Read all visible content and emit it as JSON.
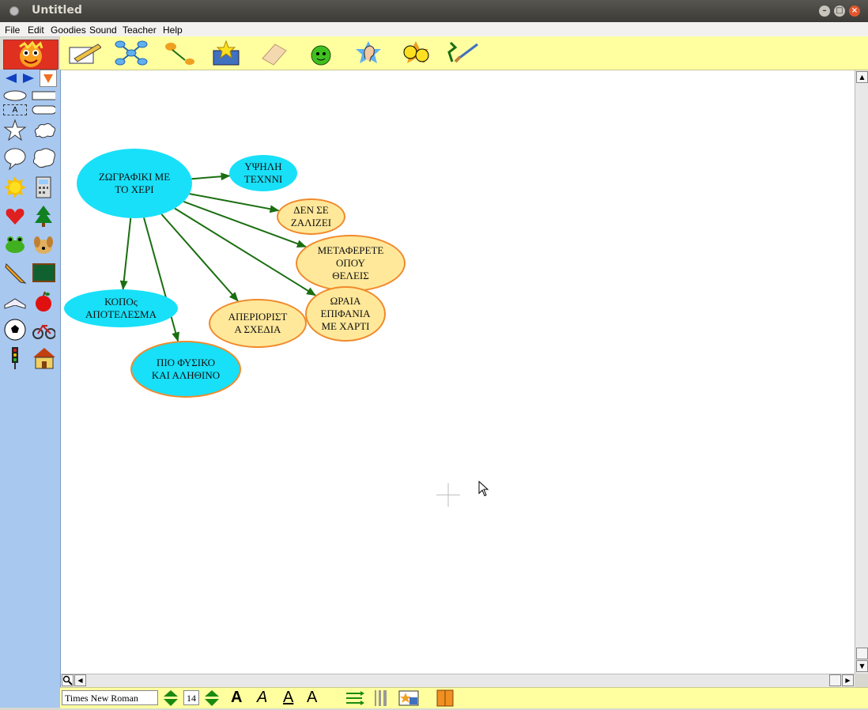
{
  "window": {
    "title": "Untitled"
  },
  "menu": [
    "File",
    "Edit",
    "Goodies",
    "Sound",
    "Teacher",
    "Help"
  ],
  "toolbar": {
    "buttons": [
      "pencil-doc-icon",
      "network-icon",
      "link-arrow-icon",
      "star-box-icon",
      "eraser-icon",
      "green-face-icon",
      "ear-icon",
      "faces-icon",
      "brush-icon"
    ]
  },
  "sidebar": {
    "nav": [
      "left-arrow-icon",
      "right-arrow-icon",
      "down-triangle-icon"
    ],
    "shape_text_label": "A",
    "symbols": [
      "star-icon",
      "cloud-icon",
      "speech-bubble-icon",
      "thought-bubble-icon",
      "sun-icon",
      "calculator-icon",
      "heart-icon",
      "tree-icon",
      "frog-icon",
      "dog-icon",
      "pencil-icon",
      "chalkboard-icon",
      "book-icon",
      "apple-icon",
      "soccer-ball-icon",
      "bicycle-icon",
      "traffic-light-icon",
      "house-icon"
    ]
  },
  "diagram": {
    "nodes": [
      {
        "id": "center",
        "text": "ΖΩΓΡΑΦΙΚΙ  ΜΕ\nΤΟ  ΧΕΡΙ",
        "style": "cyan"
      },
      {
        "id": "ypsili",
        "text": "ΥΨΗΛΗ\nΤΕΧΝΝΙ",
        "style": "cyan"
      },
      {
        "id": "den",
        "text": "ΔΕΝ   ΣΕ\nΖΑΛΙΖΕΙ",
        "style": "yellow"
      },
      {
        "id": "metaferete",
        "text": "ΜΕΤΑΦΕΡΕΤΕ\nΟΠΟΥ\nΘΕΛΕΙΣ",
        "style": "yellow"
      },
      {
        "id": "oraia",
        "text": "ΩΡΑΙΑ\nΕΠΙΦΑΝΙΑ\nΜΕ  ΧΑΡΤΙ",
        "style": "yellow"
      },
      {
        "id": "aperiorist",
        "text": "ΑΠΕΡΙΟΡΙΣΤ\nΑ  ΣΧΕΔΙΑ",
        "style": "yellow"
      },
      {
        "id": "kopos",
        "text": "ΚΟΠΟς\nΑΠΟΤΕΛΕΣΜΑ",
        "style": "cyan"
      },
      {
        "id": "pio",
        "text": "ΠΙΟ  ΦΥΣΙΚΟ\nΚΑΙ  ΑΛΗΘΙΝΟ",
        "style": "cyan-o"
      }
    ],
    "edges": [
      [
        "center",
        "ypsili"
      ],
      [
        "center",
        "den"
      ],
      [
        "center",
        "metaferete"
      ],
      [
        "center",
        "oraia"
      ],
      [
        "center",
        "aperiorist"
      ],
      [
        "center",
        "kopos"
      ],
      [
        "center",
        "pio"
      ]
    ],
    "edge_color": "#1a6e10"
  },
  "format": {
    "font": "Times New Roman",
    "size": "14",
    "bold_label": "A",
    "italic_label": "A",
    "underline_label": "A",
    "size_label": "A"
  },
  "colors": {
    "toolbar": "#ffffa0",
    "sidebar": "#a8c8f0",
    "node_cyan": "#18e0f8",
    "node_yellow": "#ffe89a",
    "node_border": "#f08a2c"
  }
}
